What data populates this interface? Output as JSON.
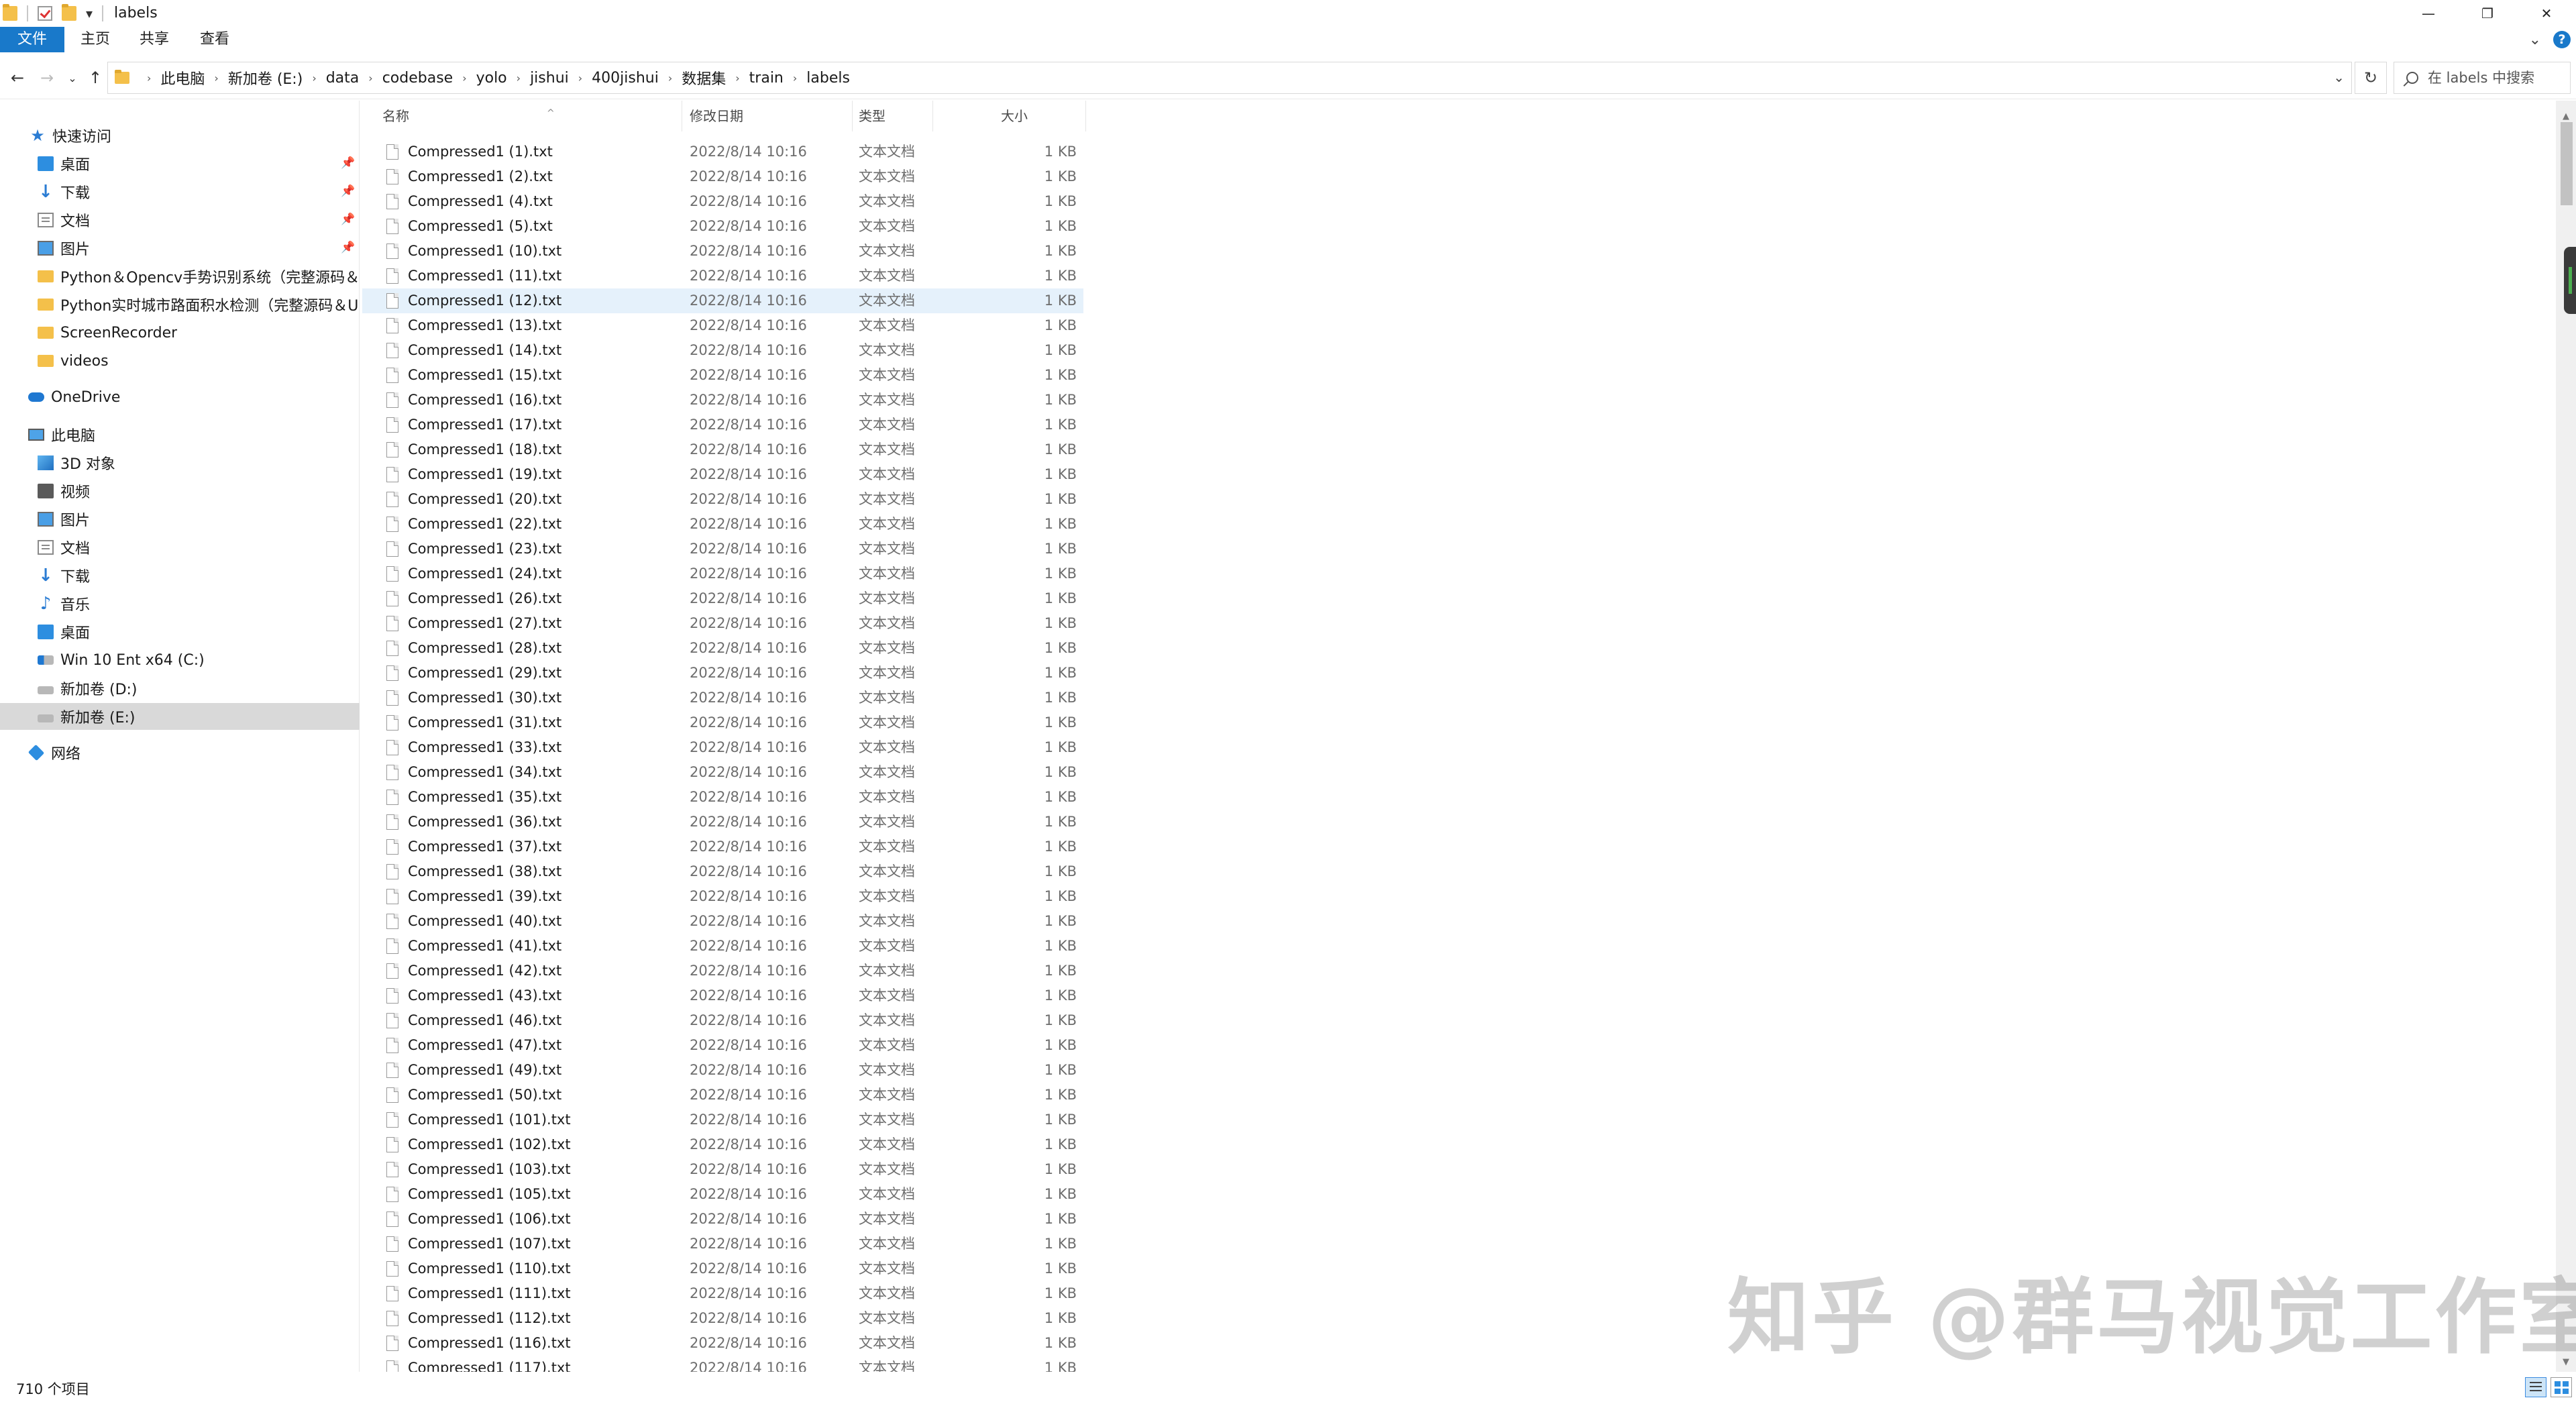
{
  "window": {
    "title": "labels"
  },
  "ribbon": {
    "tabs": [
      "文件",
      "主页",
      "共享",
      "查看"
    ]
  },
  "address": {
    "crumbs": [
      "此电脑",
      "新加卷 (E:)",
      "data",
      "codebase",
      "yolo",
      "jishui",
      "400jishui",
      "数据集",
      "train",
      "labels"
    ]
  },
  "search": {
    "placeholder": "在 labels 中搜索"
  },
  "sidebar": {
    "quick_access": "快速访问",
    "items": [
      {
        "label": "快速访问",
        "icon": "star-icon"
      },
      {
        "label": "桌面",
        "icon": "desktop-icon",
        "pinned": true
      },
      {
        "label": "下载",
        "icon": "download-icon",
        "pinned": true
      },
      {
        "label": "文档",
        "icon": "document-icon",
        "pinned": true
      },
      {
        "label": "图片",
        "icon": "pictures-icon",
        "pinned": true
      },
      {
        "label": "Python＆Opencv手势识别系统（完整源码＆自",
        "icon": "folder-icon"
      },
      {
        "label": "Python实时城市路面积水检测（完整源码＆UI界",
        "icon": "folder-icon"
      },
      {
        "label": "ScreenRecorder",
        "icon": "folder-icon"
      },
      {
        "label": "videos",
        "icon": "folder-icon"
      },
      {
        "label": "OneDrive",
        "icon": "onedrive-icon"
      },
      {
        "label": "此电脑",
        "icon": "pc-icon"
      },
      {
        "label": "3D 对象",
        "icon": "3d-objects-icon"
      },
      {
        "label": "视频",
        "icon": "videos-icon"
      },
      {
        "label": "图片",
        "icon": "pictures-icon"
      },
      {
        "label": "文档",
        "icon": "document-icon"
      },
      {
        "label": "下载",
        "icon": "download-icon"
      },
      {
        "label": "音乐",
        "icon": "music-icon"
      },
      {
        "label": "桌面",
        "icon": "desktop-icon"
      },
      {
        "label": "Win 10 Ent x64 (C:)",
        "icon": "system-drive-icon"
      },
      {
        "label": "新加卷 (D:)",
        "icon": "drive-icon"
      },
      {
        "label": "新加卷 (E:)",
        "icon": "drive-icon",
        "selected": true
      },
      {
        "label": "网络",
        "icon": "network-icon"
      }
    ]
  },
  "columns": {
    "name": "名称",
    "date": "修改日期",
    "type": "类型",
    "size": "大小"
  },
  "files": [
    {
      "name": "Compressed1 (1).txt",
      "date": "2022/8/14 10:16",
      "type": "文本文档",
      "size": "1 KB"
    },
    {
      "name": "Compressed1 (2).txt",
      "date": "2022/8/14 10:16",
      "type": "文本文档",
      "size": "1 KB"
    },
    {
      "name": "Compressed1 (4).txt",
      "date": "2022/8/14 10:16",
      "type": "文本文档",
      "size": "1 KB"
    },
    {
      "name": "Compressed1 (5).txt",
      "date": "2022/8/14 10:16",
      "type": "文本文档",
      "size": "1 KB"
    },
    {
      "name": "Compressed1 (10).txt",
      "date": "2022/8/14 10:16",
      "type": "文本文档",
      "size": "1 KB"
    },
    {
      "name": "Compressed1 (11).txt",
      "date": "2022/8/14 10:16",
      "type": "文本文档",
      "size": "1 KB"
    },
    {
      "name": "Compressed1 (12).txt",
      "date": "2022/8/14 10:16",
      "type": "文本文档",
      "size": "1 KB",
      "selected": true
    },
    {
      "name": "Compressed1 (13).txt",
      "date": "2022/8/14 10:16",
      "type": "文本文档",
      "size": "1 KB"
    },
    {
      "name": "Compressed1 (14).txt",
      "date": "2022/8/14 10:16",
      "type": "文本文档",
      "size": "1 KB"
    },
    {
      "name": "Compressed1 (15).txt",
      "date": "2022/8/14 10:16",
      "type": "文本文档",
      "size": "1 KB"
    },
    {
      "name": "Compressed1 (16).txt",
      "date": "2022/8/14 10:16",
      "type": "文本文档",
      "size": "1 KB"
    },
    {
      "name": "Compressed1 (17).txt",
      "date": "2022/8/14 10:16",
      "type": "文本文档",
      "size": "1 KB"
    },
    {
      "name": "Compressed1 (18).txt",
      "date": "2022/8/14 10:16",
      "type": "文本文档",
      "size": "1 KB"
    },
    {
      "name": "Compressed1 (19).txt",
      "date": "2022/8/14 10:16",
      "type": "文本文档",
      "size": "1 KB"
    },
    {
      "name": "Compressed1 (20).txt",
      "date": "2022/8/14 10:16",
      "type": "文本文档",
      "size": "1 KB"
    },
    {
      "name": "Compressed1 (22).txt",
      "date": "2022/8/14 10:16",
      "type": "文本文档",
      "size": "1 KB"
    },
    {
      "name": "Compressed1 (23).txt",
      "date": "2022/8/14 10:16",
      "type": "文本文档",
      "size": "1 KB"
    },
    {
      "name": "Compressed1 (24).txt",
      "date": "2022/8/14 10:16",
      "type": "文本文档",
      "size": "1 KB"
    },
    {
      "name": "Compressed1 (26).txt",
      "date": "2022/8/14 10:16",
      "type": "文本文档",
      "size": "1 KB"
    },
    {
      "name": "Compressed1 (27).txt",
      "date": "2022/8/14 10:16",
      "type": "文本文档",
      "size": "1 KB"
    },
    {
      "name": "Compressed1 (28).txt",
      "date": "2022/8/14 10:16",
      "type": "文本文档",
      "size": "1 KB"
    },
    {
      "name": "Compressed1 (29).txt",
      "date": "2022/8/14 10:16",
      "type": "文本文档",
      "size": "1 KB"
    },
    {
      "name": "Compressed1 (30).txt",
      "date": "2022/8/14 10:16",
      "type": "文本文档",
      "size": "1 KB"
    },
    {
      "name": "Compressed1 (31).txt",
      "date": "2022/8/14 10:16",
      "type": "文本文档",
      "size": "1 KB"
    },
    {
      "name": "Compressed1 (33).txt",
      "date": "2022/8/14 10:16",
      "type": "文本文档",
      "size": "1 KB"
    },
    {
      "name": "Compressed1 (34).txt",
      "date": "2022/8/14 10:16",
      "type": "文本文档",
      "size": "1 KB"
    },
    {
      "name": "Compressed1 (35).txt",
      "date": "2022/8/14 10:16",
      "type": "文本文档",
      "size": "1 KB"
    },
    {
      "name": "Compressed1 (36).txt",
      "date": "2022/8/14 10:16",
      "type": "文本文档",
      "size": "1 KB"
    },
    {
      "name": "Compressed1 (37).txt",
      "date": "2022/8/14 10:16",
      "type": "文本文档",
      "size": "1 KB"
    },
    {
      "name": "Compressed1 (38).txt",
      "date": "2022/8/14 10:16",
      "type": "文本文档",
      "size": "1 KB"
    },
    {
      "name": "Compressed1 (39).txt",
      "date": "2022/8/14 10:16",
      "type": "文本文档",
      "size": "1 KB"
    },
    {
      "name": "Compressed1 (40).txt",
      "date": "2022/8/14 10:16",
      "type": "文本文档",
      "size": "1 KB"
    },
    {
      "name": "Compressed1 (41).txt",
      "date": "2022/8/14 10:16",
      "type": "文本文档",
      "size": "1 KB"
    },
    {
      "name": "Compressed1 (42).txt",
      "date": "2022/8/14 10:16",
      "type": "文本文档",
      "size": "1 KB"
    },
    {
      "name": "Compressed1 (43).txt",
      "date": "2022/8/14 10:16",
      "type": "文本文档",
      "size": "1 KB"
    },
    {
      "name": "Compressed1 (46).txt",
      "date": "2022/8/14 10:16",
      "type": "文本文档",
      "size": "1 KB"
    },
    {
      "name": "Compressed1 (47).txt",
      "date": "2022/8/14 10:16",
      "type": "文本文档",
      "size": "1 KB"
    },
    {
      "name": "Compressed1 (49).txt",
      "date": "2022/8/14 10:16",
      "type": "文本文档",
      "size": "1 KB"
    },
    {
      "name": "Compressed1 (50).txt",
      "date": "2022/8/14 10:16",
      "type": "文本文档",
      "size": "1 KB"
    },
    {
      "name": "Compressed1 (101).txt",
      "date": "2022/8/14 10:16",
      "type": "文本文档",
      "size": "1 KB"
    },
    {
      "name": "Compressed1 (102).txt",
      "date": "2022/8/14 10:16",
      "type": "文本文档",
      "size": "1 KB"
    },
    {
      "name": "Compressed1 (103).txt",
      "date": "2022/8/14 10:16",
      "type": "文本文档",
      "size": "1 KB"
    },
    {
      "name": "Compressed1 (105).txt",
      "date": "2022/8/14 10:16",
      "type": "文本文档",
      "size": "1 KB"
    },
    {
      "name": "Compressed1 (106).txt",
      "date": "2022/8/14 10:16",
      "type": "文本文档",
      "size": "1 KB"
    },
    {
      "name": "Compressed1 (107).txt",
      "date": "2022/8/14 10:16",
      "type": "文本文档",
      "size": "1 KB"
    },
    {
      "name": "Compressed1 (110).txt",
      "date": "2022/8/14 10:16",
      "type": "文本文档",
      "size": "1 KB"
    },
    {
      "name": "Compressed1 (111).txt",
      "date": "2022/8/14 10:16",
      "type": "文本文档",
      "size": "1 KB"
    },
    {
      "name": "Compressed1 (112).txt",
      "date": "2022/8/14 10:16",
      "type": "文本文档",
      "size": "1 KB"
    },
    {
      "name": "Compressed1 (116).txt",
      "date": "2022/8/14 10:16",
      "type": "文本文档",
      "size": "1 KB"
    },
    {
      "name": "Compressed1 (117).txt",
      "date": "2022/8/14 10:16",
      "type": "文本文档",
      "size": "1 KB"
    }
  ],
  "status": {
    "item_count": "710 个项目"
  },
  "watermark": "知乎 @群马视觉工作室",
  "colors": {
    "accent": "#1979ca",
    "selected_row": "#e5f1fb",
    "selected_nav": "#d9d9d9"
  }
}
